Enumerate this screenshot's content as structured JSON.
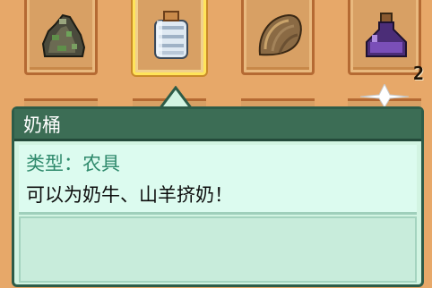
{
  "inventory": {
    "slots": [
      {
        "item_icon": "ore-rock-icon"
      },
      {
        "item_icon": "milk-pail-icon",
        "selected": true
      },
      {
        "item_icon": "seed-sack-icon"
      },
      {
        "item_icon": "purple-potion-icon",
        "count": "2"
      }
    ],
    "colors": {
      "wood": "#d8a064",
      "wood_border": "#b56a33",
      "select": "#ffe45a"
    }
  },
  "tooltip": {
    "title": "奶桶",
    "type_line": "类型：农具",
    "description": "可以为奶牛、山羊挤奶！",
    "colors": {
      "header": "#3c6d55",
      "body": "#dcfbef",
      "type_text": "#2f8a6c"
    }
  }
}
